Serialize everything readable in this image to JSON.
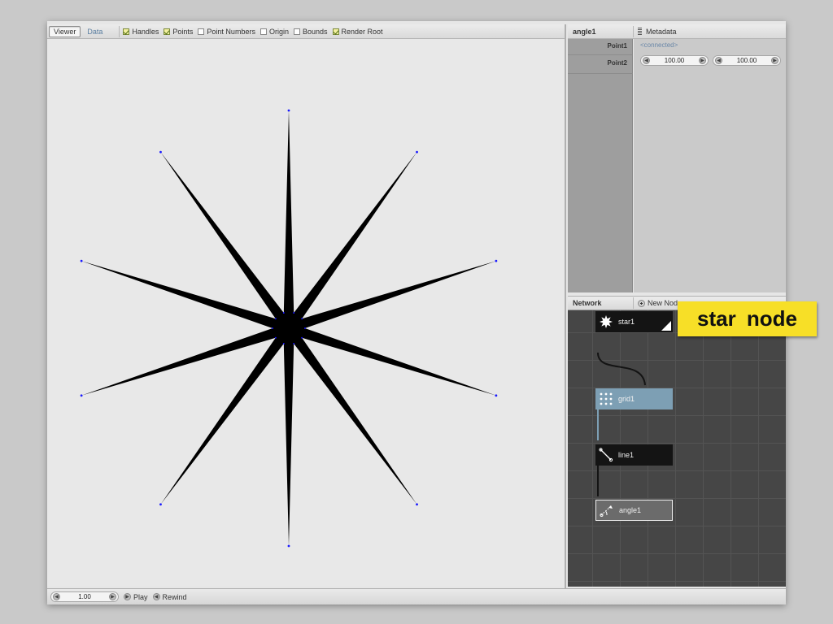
{
  "viewer": {
    "tabs": [
      {
        "label": "Viewer",
        "active": true
      },
      {
        "label": "Data",
        "active": false
      }
    ],
    "options": [
      {
        "label": "Handles",
        "checked": true
      },
      {
        "label": "Points",
        "checked": true
      },
      {
        "label": "Point Numbers",
        "checked": false
      },
      {
        "label": "Origin",
        "checked": false
      },
      {
        "label": "Bounds",
        "checked": false
      },
      {
        "label": "Render Root",
        "checked": true
      }
    ],
    "shape": {
      "type": "star",
      "points": 10,
      "fill": "#000000",
      "handle_color": "#1a1aff"
    }
  },
  "parameters": {
    "node_name": "angle1",
    "metadata_label": "Metadata",
    "point1": {
      "label": "Point1",
      "value": "<connected>"
    },
    "point2": {
      "label": "Point2",
      "x": "100.00",
      "y": "100.00"
    }
  },
  "network": {
    "title": "Network",
    "new_node_label": "New Node",
    "nodes": [
      {
        "name": "star1",
        "icon": "star-icon",
        "rendered": true
      },
      {
        "name": "grid1",
        "icon": "grid-icon",
        "selected": true
      },
      {
        "name": "line1",
        "icon": "line-icon"
      },
      {
        "name": "angle1",
        "icon": "angle-icon",
        "active": true
      }
    ],
    "colors": {
      "grid_node": "#7d9fb4",
      "canvas": "#464646",
      "node": "#141414"
    }
  },
  "playback": {
    "frame": "1.00",
    "play_label": "Play",
    "rewind_label": "Rewind"
  },
  "annotation": {
    "text": "star  node",
    "color": "#f7df27"
  }
}
